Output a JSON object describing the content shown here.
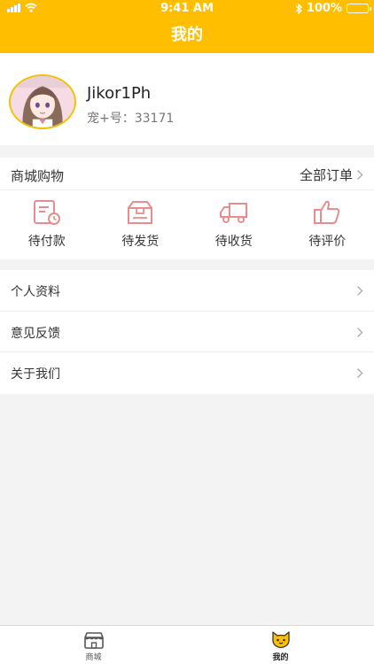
{
  "status_bar": {
    "time": "9:41 AM",
    "battery": "100%"
  },
  "nav": {
    "title": "我的"
  },
  "profile": {
    "username": "Jikor1Ph",
    "pet_id": "宠+号：33171"
  },
  "shop": {
    "title": "商城购物",
    "all_orders": "全部订单",
    "orders": [
      {
        "label": "待付款",
        "icon": "pending-payment-icon"
      },
      {
        "label": "待发货",
        "icon": "box-icon"
      },
      {
        "label": "待收货",
        "icon": "truck-icon"
      },
      {
        "label": "待评价",
        "icon": "thumbs-up-icon"
      }
    ]
  },
  "menu": [
    {
      "label": "个人资料"
    },
    {
      "label": "意见反馈"
    },
    {
      "label": "关于我们"
    }
  ],
  "tabs": [
    {
      "label": "商城",
      "icon": "store-icon",
      "active": false
    },
    {
      "label": "我的",
      "icon": "cat-face-icon",
      "active": true
    }
  ],
  "colors": {
    "accent": "#ffbe00",
    "icon_pink": "#e88d8d"
  }
}
